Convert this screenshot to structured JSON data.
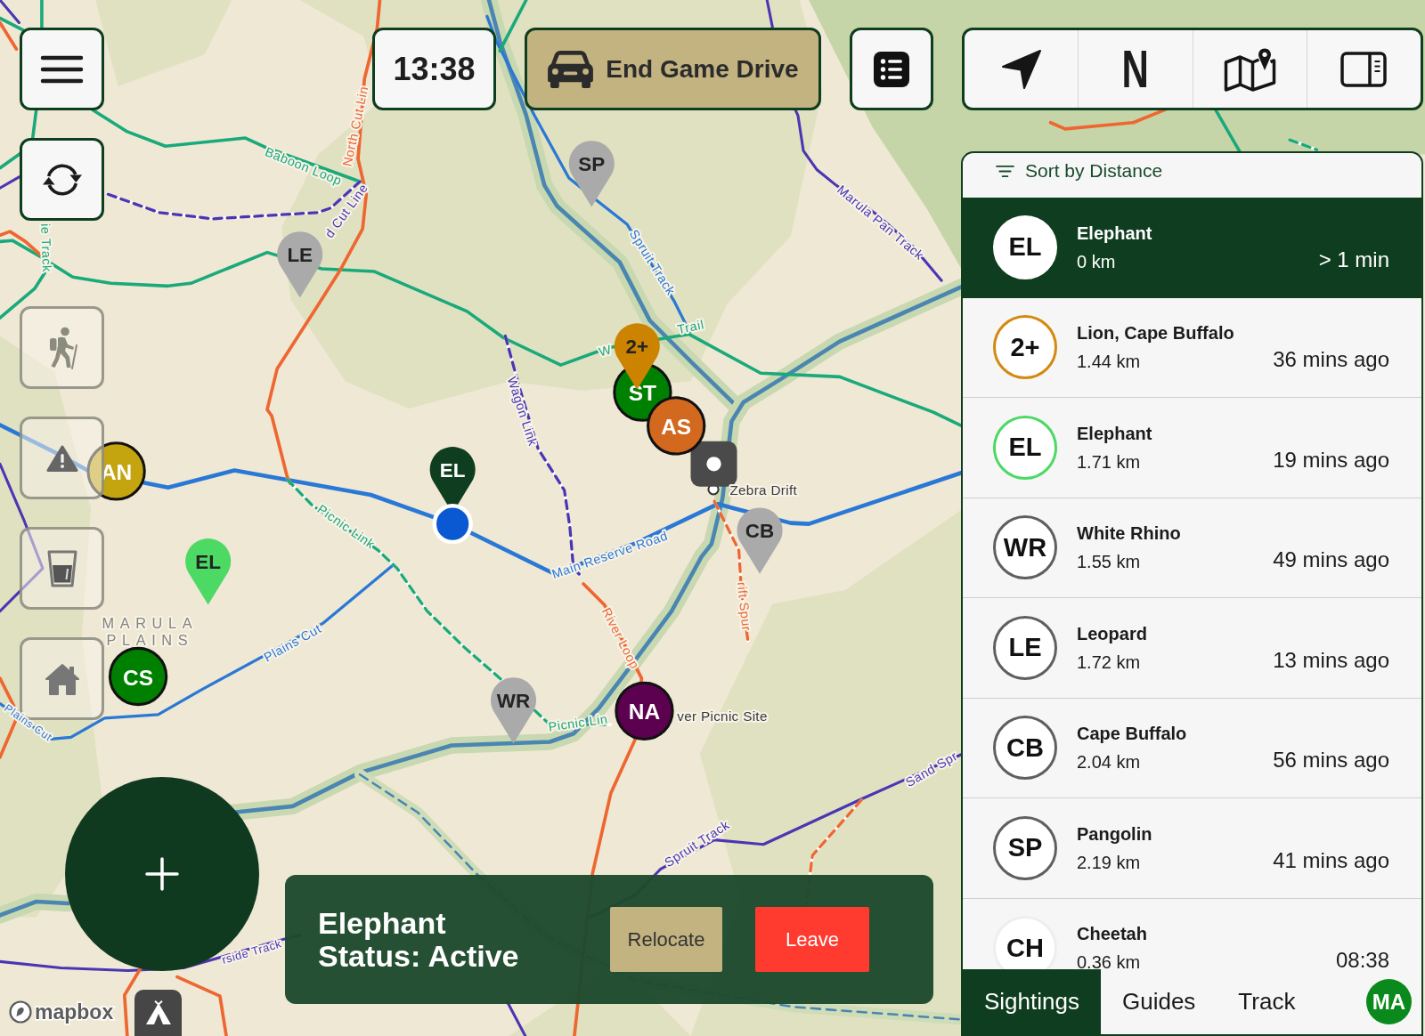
{
  "left_controls": {
    "layer_buttons": [
      {
        "on": false
      },
      {
        "on": false
      },
      {
        "on": false
      },
      {
        "on": false
      }
    ]
  },
  "top_bar": {
    "time": "13:38",
    "end_drive_label": "End Game Drive",
    "north_label": "N"
  },
  "map": {
    "area_label": [
      "MARULA",
      "PLAINS"
    ],
    "place_labels": [
      "Zebra Drift",
      "ver Picnic Site"
    ],
    "road_labels": [
      {
        "text": "Baboon Loop",
        "color": "#1aa87b"
      },
      {
        "text": "North Cut Lin",
        "color": "#ee6630"
      },
      {
        "text": "d Cut Line",
        "color": "#4a36b3"
      },
      {
        "text": "ie Track",
        "color": "#1aa87b"
      },
      {
        "text": "Marula Pan Track",
        "color": "#4a36b3"
      },
      {
        "text": "Spruit Track",
        "color": "#2a78d6"
      },
      {
        "text": "W",
        "color": "#1aa87b"
      },
      {
        "text": "Trail",
        "color": "#1aa87b"
      },
      {
        "text": "Wagon Link",
        "color": "#4a36b3"
      },
      {
        "text": "Picnic Link",
        "color": "#1aa87b"
      },
      {
        "text": "Main Reserve Road",
        "color": "#2a78d6"
      },
      {
        "text": "rift Spur",
        "color": "#ee6630"
      },
      {
        "text": "River Loop",
        "color": "#ee6630"
      },
      {
        "text": "Plains Cut",
        "color": "#2a78d6"
      },
      {
        "text": "Plains Cut",
        "color": "#2a78d6"
      },
      {
        "text": "Picnic Lin",
        "color": "#1aa87b"
      },
      {
        "text": "Sand Spr",
        "color": "#4a36b3"
      },
      {
        "text": "Spruit Track",
        "color": "#4a36b3"
      },
      {
        "text": "rside Track",
        "color": "#4a36b3"
      }
    ],
    "markers": [
      {
        "label": "SP",
        "kind": "pin",
        "color": "#aaaaaa"
      },
      {
        "label": "LE",
        "kind": "pin",
        "color": "#aaaaaa"
      },
      {
        "label": "ST",
        "kind": "circle",
        "color": "#008000"
      },
      {
        "label": "AS",
        "kind": "circle",
        "color": "#d2691e"
      },
      {
        "label": "2+",
        "kind": "pin",
        "color": "#cc8400"
      },
      {
        "label": "AN",
        "kind": "circle",
        "color": "#c4a510"
      },
      {
        "label": "EL",
        "kind": "pin",
        "color": "#0f3d1f"
      },
      {
        "label": "CB",
        "kind": "pin",
        "color": "#aaaaaa"
      },
      {
        "label": "EL",
        "kind": "pin",
        "color": "#4cd964"
      },
      {
        "label": "CS",
        "kind": "circle",
        "color": "#008000"
      },
      {
        "label": "WR",
        "kind": "pin",
        "color": "#aaaaaa"
      },
      {
        "label": "NA",
        "kind": "circle",
        "color": "#5c0050"
      }
    ],
    "attribution": "mapbox"
  },
  "sightings_panel": {
    "sort_label": "Sort by Distance",
    "rows": [
      {
        "badge": "EL",
        "name": "Elephant",
        "distance": "0 km",
        "time": "> 1 min",
        "selected": true,
        "color": "#ffffff"
      },
      {
        "badge": "2+",
        "name": "Lion, Cape Buffalo",
        "distance": "1.44 km",
        "time": "36 mins ago",
        "selected": false,
        "color": "#d4890f"
      },
      {
        "badge": "EL",
        "name": "Elephant",
        "distance": "1.71 km",
        "time": "19 mins ago",
        "selected": false,
        "color": "#4cd964"
      },
      {
        "badge": "WR",
        "name": "White Rhino",
        "distance": "1.55 km",
        "time": "49 mins ago",
        "selected": false,
        "color": "#5f5f5f"
      },
      {
        "badge": "LE",
        "name": "Leopard",
        "distance": "1.72 km",
        "time": "13 mins ago",
        "selected": false,
        "color": "#5f5f5f"
      },
      {
        "badge": "CB",
        "name": "Cape Buffalo",
        "distance": "2.04 km",
        "time": "56 mins ago",
        "selected": false,
        "color": "#5f5f5f"
      },
      {
        "badge": "SP",
        "name": "Pangolin",
        "distance": "2.19 km",
        "time": "41 mins ago",
        "selected": false,
        "color": "#5f5f5f"
      },
      {
        "badge": "CH",
        "name": "Cheetah",
        "distance": "0.36 km",
        "time": "08:38",
        "selected": false,
        "color": "#eeeeee"
      }
    ],
    "tabs": [
      {
        "label": "Sightings",
        "selected": true
      },
      {
        "label": "Guides",
        "selected": false
      },
      {
        "label": "Track",
        "selected": false
      }
    ],
    "avatar": "MA"
  },
  "status_card": {
    "title": "Elephant",
    "status": "Status: Active",
    "buttons": [
      {
        "label": "Relocate",
        "kind": "secondary"
      },
      {
        "label": "Leave",
        "kind": "danger"
      }
    ]
  }
}
